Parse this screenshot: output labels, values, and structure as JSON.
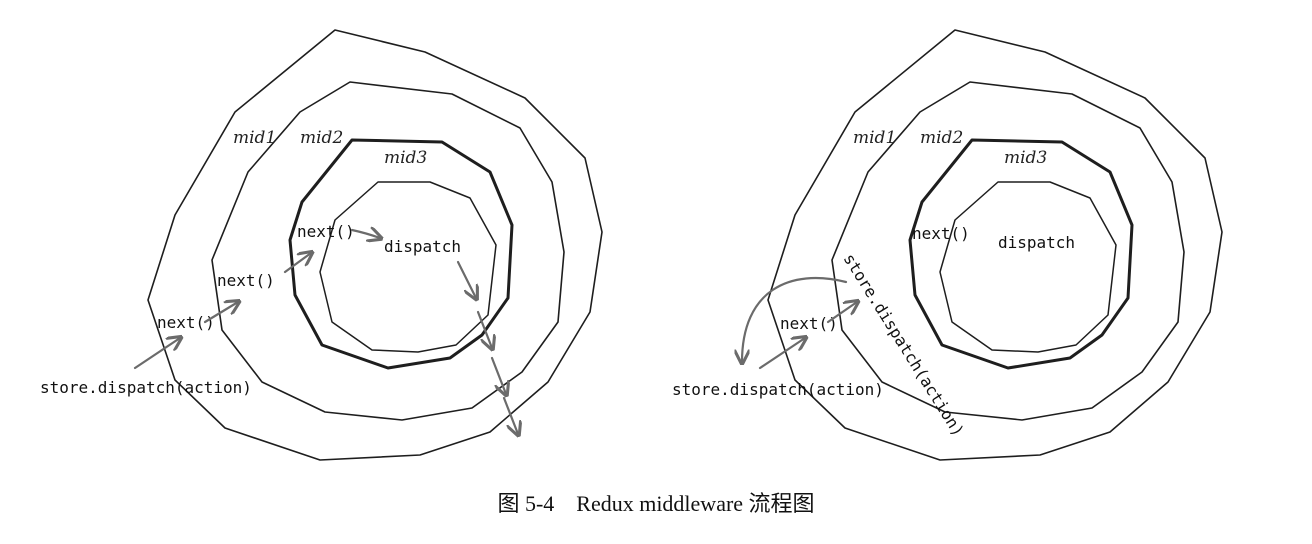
{
  "diagrams": [
    {
      "ring_labels": [
        "mid1",
        "mid2",
        "mid3"
      ],
      "core_label": "dispatch",
      "entry_label": "store.dispatch(action)",
      "next_labels": [
        "next()",
        "next()",
        "next()"
      ]
    },
    {
      "ring_labels": [
        "mid1",
        "mid2",
        "mid3"
      ],
      "core_label": "dispatch",
      "entry_label": "store.dispatch(action)",
      "next_labels": [
        "next()",
        "next()"
      ],
      "redispatch_label": "store.dispatch(action)"
    }
  ],
  "caption": "图 5-4　Redux middleware 流程图"
}
